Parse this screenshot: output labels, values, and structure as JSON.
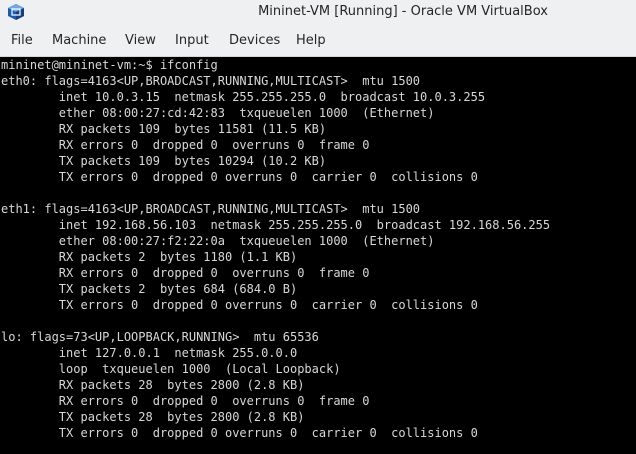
{
  "window": {
    "title": "Mininet-VM [Running] - Oracle VM VirtualBox",
    "icon": "virtualbox-icon"
  },
  "menu": {
    "items": [
      "File",
      "Machine",
      "View",
      "Input",
      "Devices",
      "Help"
    ]
  },
  "colors": {
    "chrome": "#eff0f1",
    "terminal_bg": "#000000",
    "terminal_fg": "#d8d8d8",
    "vbox_blue": "#1d5aa8"
  },
  "terminal": {
    "lines": [
      "mininet@mininet-vm:~$ ifconfig",
      "eth0: flags=4163<UP,BROADCAST,RUNNING,MULTICAST>  mtu 1500",
      "        inet 10.0.3.15  netmask 255.255.255.0  broadcast 10.0.3.255",
      "        ether 08:00:27:cd:42:83  txqueuelen 1000  (Ethernet)",
      "        RX packets 109  bytes 11581 (11.5 KB)",
      "        RX errors 0  dropped 0  overruns 0  frame 0",
      "        TX packets 109  bytes 10294 (10.2 KB)",
      "        TX errors 0  dropped 0 overruns 0  carrier 0  collisions 0",
      "",
      "eth1: flags=4163<UP,BROADCAST,RUNNING,MULTICAST>  mtu 1500",
      "        inet 192.168.56.103  netmask 255.255.255.0  broadcast 192.168.56.255",
      "        ether 08:00:27:f2:22:0a  txqueuelen 1000  (Ethernet)",
      "        RX packets 2  bytes 1180 (1.1 KB)",
      "        RX errors 0  dropped 0  overruns 0  frame 0",
      "        TX packets 2  bytes 684 (684.0 B)",
      "        TX errors 0  dropped 0 overruns 0  carrier 0  collisions 0",
      "",
      "lo: flags=73<UP,LOOPBACK,RUNNING>  mtu 65536",
      "        inet 127.0.0.1  netmask 255.0.0.0",
      "        loop  txqueuelen 1000  (Local Loopback)",
      "        RX packets 28  bytes 2800 (2.8 KB)",
      "        RX errors 0  dropped 0  overruns 0  frame 0",
      "        TX packets 28  bytes 2800 (2.8 KB)",
      "        TX errors 0  dropped 0 overruns 0  carrier 0  collisions 0"
    ]
  }
}
